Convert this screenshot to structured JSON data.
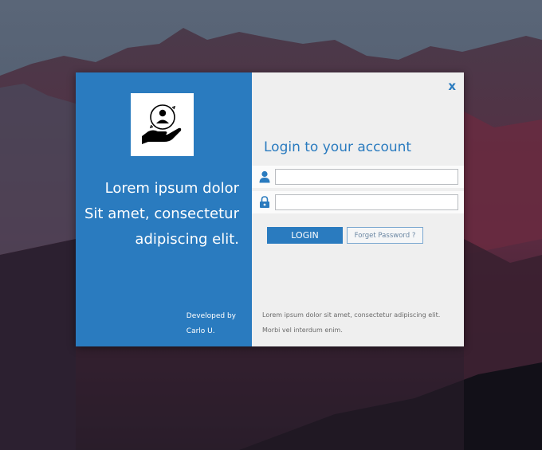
{
  "left_panel": {
    "tagline": [
      "Lorem ipsum dolor",
      "Sit amet, consectetur",
      "adipiscing elit."
    ],
    "developer_line1": "Developed by",
    "developer_line2": "Carlo U."
  },
  "form": {
    "title": "Login to your account",
    "close_label": "x",
    "username_value": "",
    "password_value": "",
    "login_label": "LOGIN",
    "forget_label": "Forget Password ?"
  },
  "footer": {
    "line1": "Lorem ipsum dolor sit amet, consectetur adipiscing elit.",
    "line2": "Morbi vel interdum enim."
  },
  "colors": {
    "accent": "#2a7bbf",
    "panel": "#efefef"
  },
  "icons": [
    "hand-user-logo-icon",
    "user-icon",
    "lock-icon",
    "close-icon"
  ]
}
